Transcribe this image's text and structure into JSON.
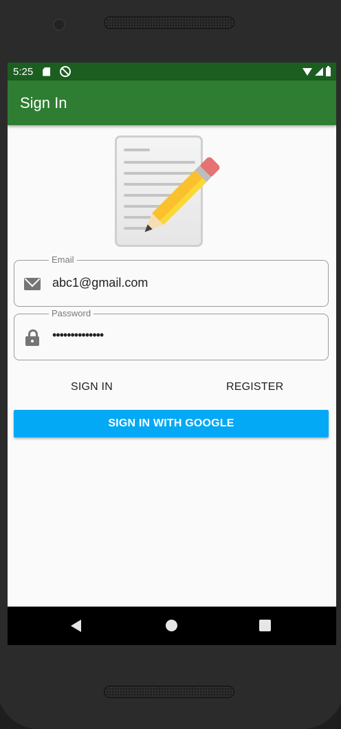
{
  "status_bar": {
    "time": "5:25",
    "icons": [
      "sd-card-icon",
      "sync-disabled-icon",
      "wifi-icon",
      "signal-icon",
      "battery-icon"
    ]
  },
  "app_bar": {
    "title": "Sign In"
  },
  "logo": {
    "icon": "notepad-pencil-icon"
  },
  "email_field": {
    "label": "Email",
    "value": "abc1@gmail.com",
    "icon": "mail-icon"
  },
  "password_field": {
    "label": "Password",
    "value": "••••••••••••••",
    "icon": "lock-icon"
  },
  "buttons": {
    "sign_in": "SIGN IN",
    "register": "REGISTER",
    "google": "SIGN IN WITH GOOGLE"
  },
  "colors": {
    "status_bar": "#1b5e20",
    "app_bar": "#2e7d32",
    "google_button": "#03a9f4",
    "background": "#fafafa"
  },
  "nav_bar": {
    "icons": [
      "back-icon",
      "home-icon",
      "recents-icon"
    ]
  }
}
